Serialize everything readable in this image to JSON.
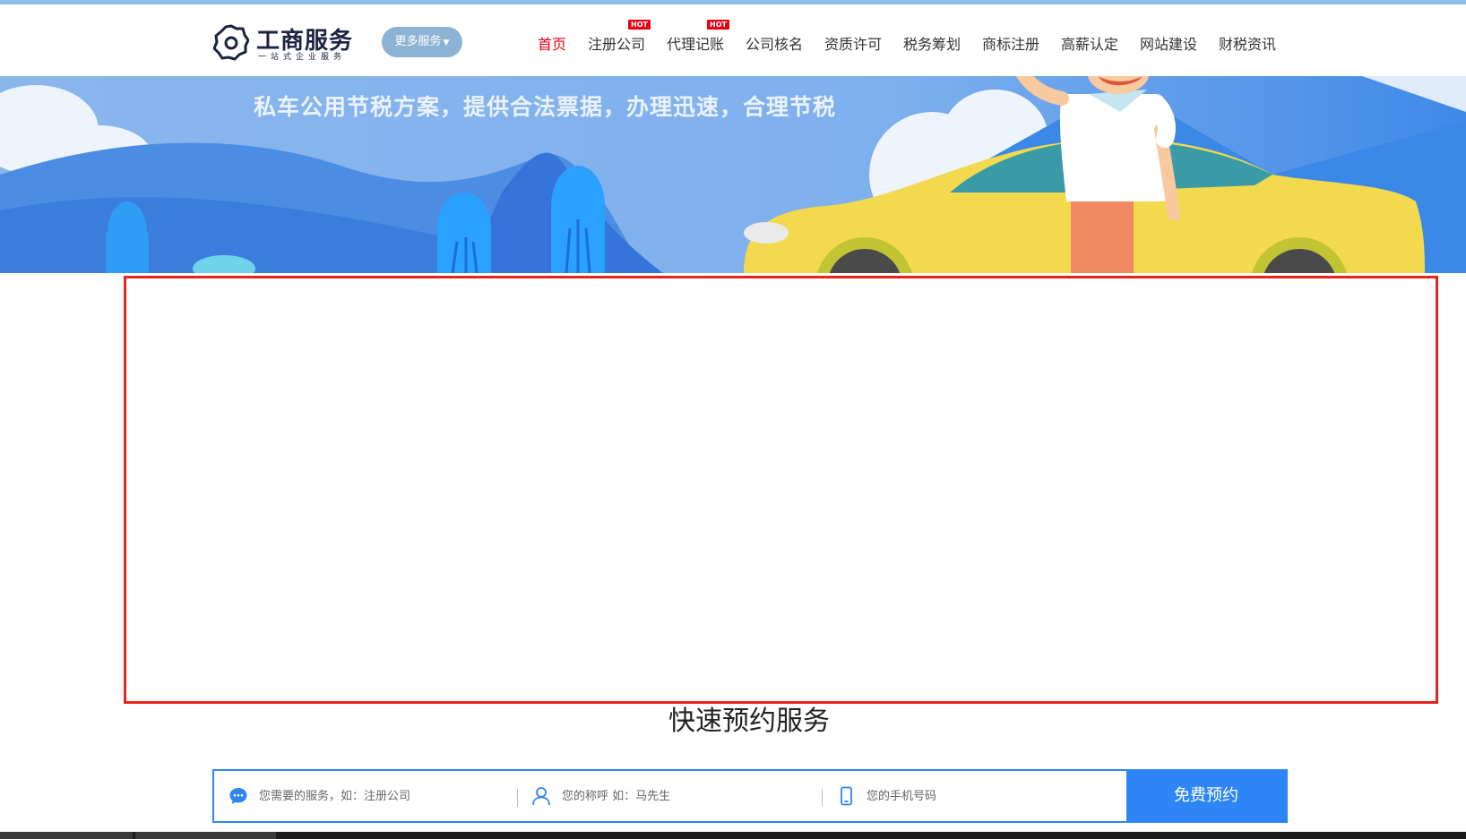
{
  "header": {
    "logo_title": "工商服务",
    "logo_subtitle": "一站式企业服务",
    "more_button": "更多服务",
    "nav": [
      {
        "label": "首页",
        "active": true,
        "hot": false
      },
      {
        "label": "注册公司",
        "active": false,
        "hot": true
      },
      {
        "label": "代理记账",
        "active": false,
        "hot": true
      },
      {
        "label": "公司核名",
        "active": false,
        "hot": false
      },
      {
        "label": "资质许可",
        "active": false,
        "hot": false
      },
      {
        "label": "税务筹划",
        "active": false,
        "hot": false
      },
      {
        "label": "商标注册",
        "active": false,
        "hot": false
      },
      {
        "label": "高薪认定",
        "active": false,
        "hot": false
      },
      {
        "label": "网站建设",
        "active": false,
        "hot": false
      },
      {
        "label": "财税资讯",
        "active": false,
        "hot": false
      }
    ],
    "hot_badge": "HOT"
  },
  "banner": {
    "text": "私车公用节税方案，提供合法票据，办理迅速，合理节税"
  },
  "booking": {
    "title": "快速预约服务",
    "service_placeholder": "您需要的服务，如：注册公司",
    "name_placeholder": "您的称呼 如：马先生",
    "phone_placeholder": "您的手机号码",
    "submit_label": "免费预约"
  },
  "colors": {
    "accent": "#2e86f6",
    "active_nav": "#e60012",
    "frame": "#e8231b",
    "banner_sky": "#8ab6ec"
  },
  "icons": {
    "logo": "gear-icon",
    "service": "chat-bubble-icon",
    "name": "user-icon",
    "phone": "phone-icon"
  }
}
